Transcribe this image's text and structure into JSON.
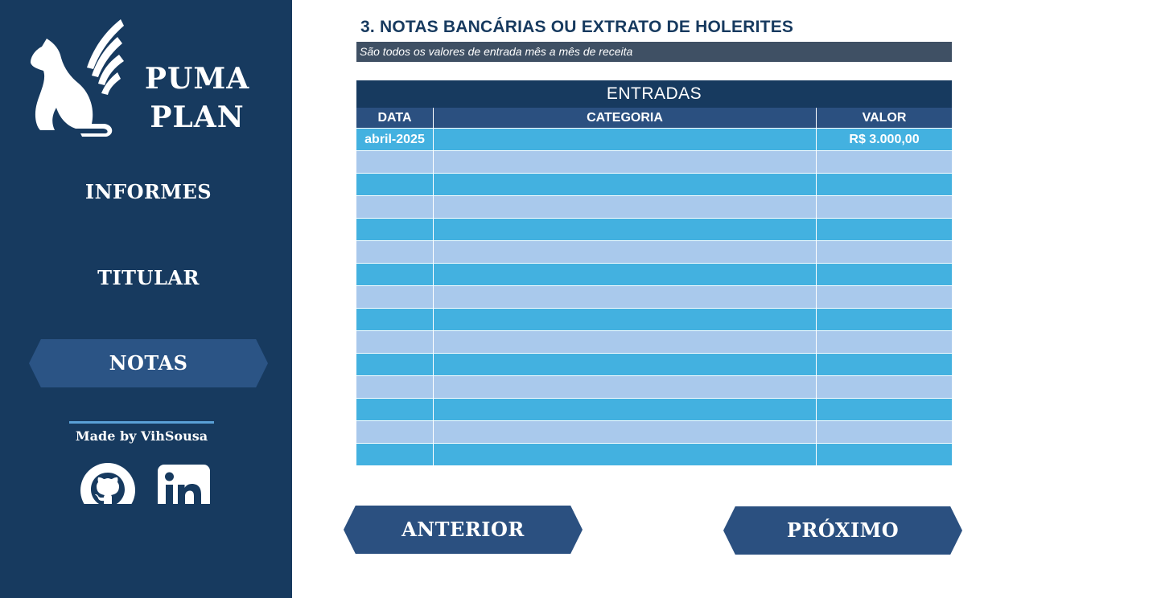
{
  "brand": {
    "line1": "PUMA",
    "line2": "PLAN",
    "logo_icon": "winged-puma-icon"
  },
  "sidebar": {
    "items": [
      {
        "label": "INFORMES",
        "active": false
      },
      {
        "label": "TITULAR",
        "active": false
      },
      {
        "label": "NOTAS",
        "active": true
      }
    ],
    "credit": "Made by VihSousa",
    "social": [
      {
        "icon": "github-icon"
      },
      {
        "icon": "linkedin-icon"
      }
    ]
  },
  "main": {
    "title": "3. NOTAS BANCÁRIAS OU EXTRATO DE HOLERITES",
    "subtitle": "São todos os valores de entrada mês a mês de receita"
  },
  "table": {
    "title": "ENTRADAS",
    "columns": [
      "DATA",
      "CATEGORIA",
      "VALOR"
    ],
    "rows": [
      [
        "abril-2025",
        "",
        "R$ 3.000,00"
      ],
      [
        "",
        "",
        ""
      ],
      [
        "",
        "",
        ""
      ],
      [
        "",
        "",
        ""
      ],
      [
        "",
        "",
        ""
      ],
      [
        "",
        "",
        ""
      ],
      [
        "",
        "",
        ""
      ],
      [
        "",
        "",
        ""
      ],
      [
        "",
        "",
        ""
      ],
      [
        "",
        "",
        ""
      ],
      [
        "",
        "",
        ""
      ],
      [
        "",
        "",
        ""
      ],
      [
        "",
        "",
        ""
      ],
      [
        "",
        "",
        ""
      ],
      [
        "",
        "",
        ""
      ]
    ]
  },
  "nav_buttons": {
    "prev": "ANTERIOR",
    "next": "PRÓXIMO"
  },
  "colors": {
    "sidebar": "#173a5f",
    "button": "#2b5080",
    "row_dark": "#43b1e0",
    "row_light": "#a9c9ec",
    "subtitle_bar": "#3f5064"
  }
}
